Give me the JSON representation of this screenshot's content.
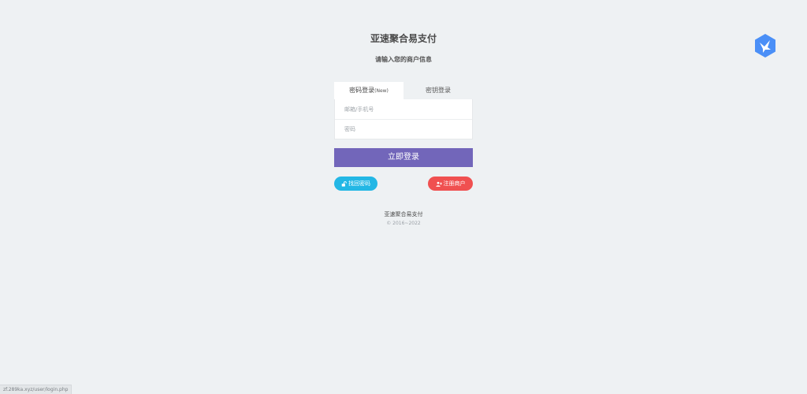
{
  "header": {
    "title": "亚速聚合易支付",
    "subtitle": "请输入您的商户信息"
  },
  "brand": {
    "logo_icon": "bird-hexagon-logo",
    "logo_color": "#4a8ff7"
  },
  "login": {
    "tabs": [
      {
        "label": "密码登录",
        "tag": "(New)",
        "active": true
      },
      {
        "label": "密钥登录",
        "tag": "",
        "active": false
      }
    ],
    "account_placeholder": "邮箱/手机号",
    "password_placeholder": "密码",
    "submit_label": "立即登录",
    "submit_color": "#7266ba"
  },
  "links": {
    "forgot_label": "找回密码",
    "forgot_icon": "unlock-icon",
    "forgot_color": "#23b7e5",
    "register_label": "注册商户",
    "register_icon": "user-plus-icon",
    "register_color": "#f05050"
  },
  "footer": {
    "name": "亚速聚合易支付",
    "copyright": "© 2016~2022"
  },
  "status_bar": {
    "url": "zf.289ka.xyz/user/login.php"
  }
}
